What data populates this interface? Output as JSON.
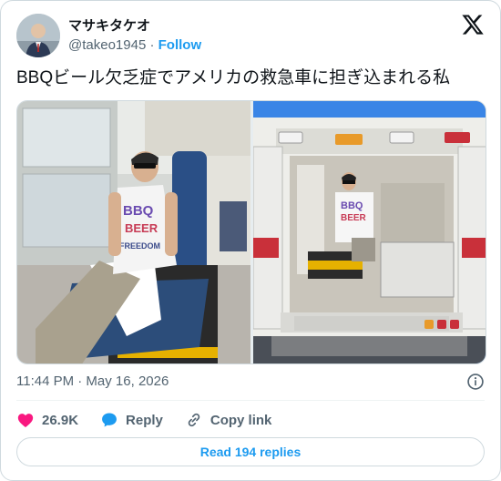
{
  "author": {
    "name": "マサキタケオ",
    "handle": "@takeo1945",
    "separator": " · ",
    "follow_label": "Follow"
  },
  "tweet": {
    "text": "BBQビール欠乏症でアメリカの救急車に担ぎ込まれる私",
    "timestamp": "11:44 PM · May 16, 2026"
  },
  "media": {
    "left_shirt_text": [
      "BBQ",
      "BEER",
      "FREEDOM"
    ],
    "right_shirt_text": [
      "BBQ",
      "BEER"
    ]
  },
  "actions": {
    "likes": "26.9K",
    "reply_label": "Reply",
    "copy_link_label": "Copy link",
    "read_replies_label": "Read 194 replies"
  },
  "icons": {
    "brand": "x-logo-icon",
    "info": "info-icon",
    "like": "heart-icon",
    "reply": "reply-bubble-icon",
    "copy": "link-icon"
  },
  "colors": {
    "accent": "#1d9bf0",
    "like": "#f91880",
    "text": "#0f1419",
    "muted": "#536471",
    "border": "#cfd9de"
  }
}
